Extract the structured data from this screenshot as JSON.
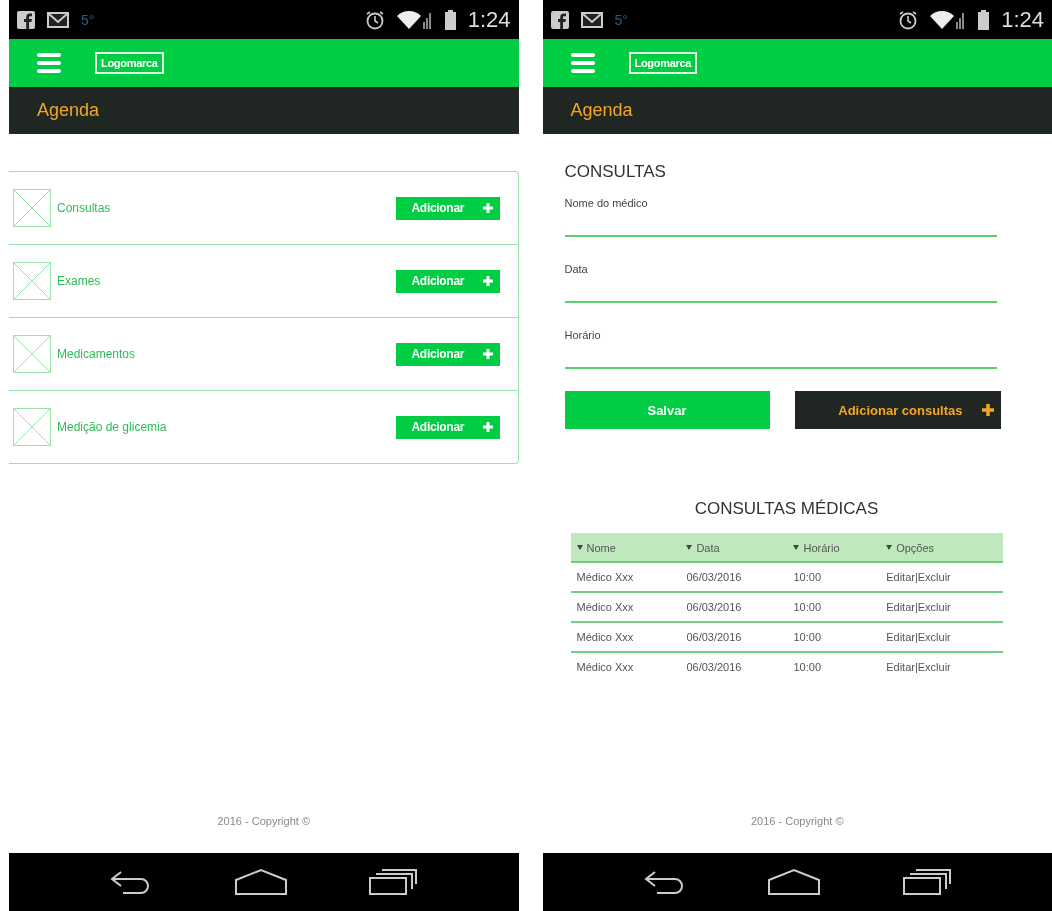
{
  "screens": [
    {
      "kind": "categories",
      "status_bar": {
        "notification": "5°",
        "time": "1:24"
      },
      "app_bar": {
        "logo": "Logomarca"
      },
      "title": "Agenda",
      "categories": [
        {
          "label": "Consultas",
          "button": "Adicionar"
        },
        {
          "label": "Exames",
          "button": "Adicionar"
        },
        {
          "label": "Medicamentos",
          "button": "Adicionar"
        },
        {
          "label": "Medição de glicemia",
          "button": "Adicionar"
        }
      ],
      "footer": "2016 - Copyright ©"
    },
    {
      "kind": "form",
      "status_bar": {
        "notification": "5°",
        "time": "1:24"
      },
      "app_bar": {
        "logo": "Logomarca"
      },
      "title": "Agenda",
      "form": {
        "heading": "CONSULTAS",
        "fields": [
          {
            "label": "Nome do médico"
          },
          {
            "label": "Data"
          },
          {
            "label": "Horário"
          }
        ],
        "save_button": "Salvar",
        "add_button": "Adicionar consultas"
      },
      "table": {
        "title": "CONSULTAS MÉDICAS",
        "columns": [
          "Nome",
          "Data",
          "Horário",
          "Opções"
        ],
        "rows": [
          [
            "Médico Xxx",
            "06/03/2016",
            "10:00",
            "Editar|Excluir"
          ],
          [
            "Médico Xxx",
            "06/03/2016",
            "10:00",
            "Editar|Excluir"
          ],
          [
            "Médico Xxx",
            "06/03/2016",
            "10:00",
            "Editar|Excluir"
          ],
          [
            "Médico Xxx",
            "06/03/2016",
            "10:00",
            "Editar|Excluir"
          ]
        ]
      },
      "footer": "2016 - Copyright ©"
    }
  ]
}
